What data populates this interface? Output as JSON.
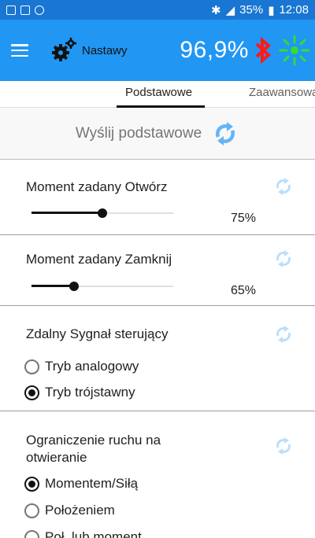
{
  "status_bar": {
    "battery": "35%",
    "time": "12:08"
  },
  "app_bar": {
    "title": "Nastawy",
    "battery_percent": "96,9%",
    "colors": {
      "bar": "#2196f3",
      "bluetooth": "#ff1a1a",
      "light": "#33dd33"
    },
    "icons": [
      "menu-icon",
      "gears-icon",
      "bluetooth-icon",
      "light-indicator-icon"
    ]
  },
  "tabs": [
    {
      "label": "Podstawowe",
      "active": true
    },
    {
      "label": "Zaawansowa",
      "active": false
    }
  ],
  "send": {
    "label": "Wyślij podstawowe"
  },
  "sections": {
    "moment_open": {
      "title": "Moment zadany Otwórz",
      "value": "75%",
      "level": 0.5
    },
    "moment_close": {
      "title": "Moment zadany Zamknij",
      "value": "65%",
      "level": 0.3
    },
    "remote_signal": {
      "title": "Zdalny Sygnał sterujący",
      "options": [
        {
          "label": "Tryb analogowy",
          "checked": false
        },
        {
          "label": "Tryb trójstawny",
          "checked": true
        }
      ]
    },
    "motion_limit": {
      "title_line1": "Ograniczenie ruchu na",
      "title_line2": "otwieranie",
      "options": [
        {
          "label": "Momentem/Siłą",
          "checked": true
        },
        {
          "label": "Położeniem",
          "checked": false
        },
        {
          "label": "Poł. lub moment",
          "checked": false
        }
      ]
    }
  }
}
